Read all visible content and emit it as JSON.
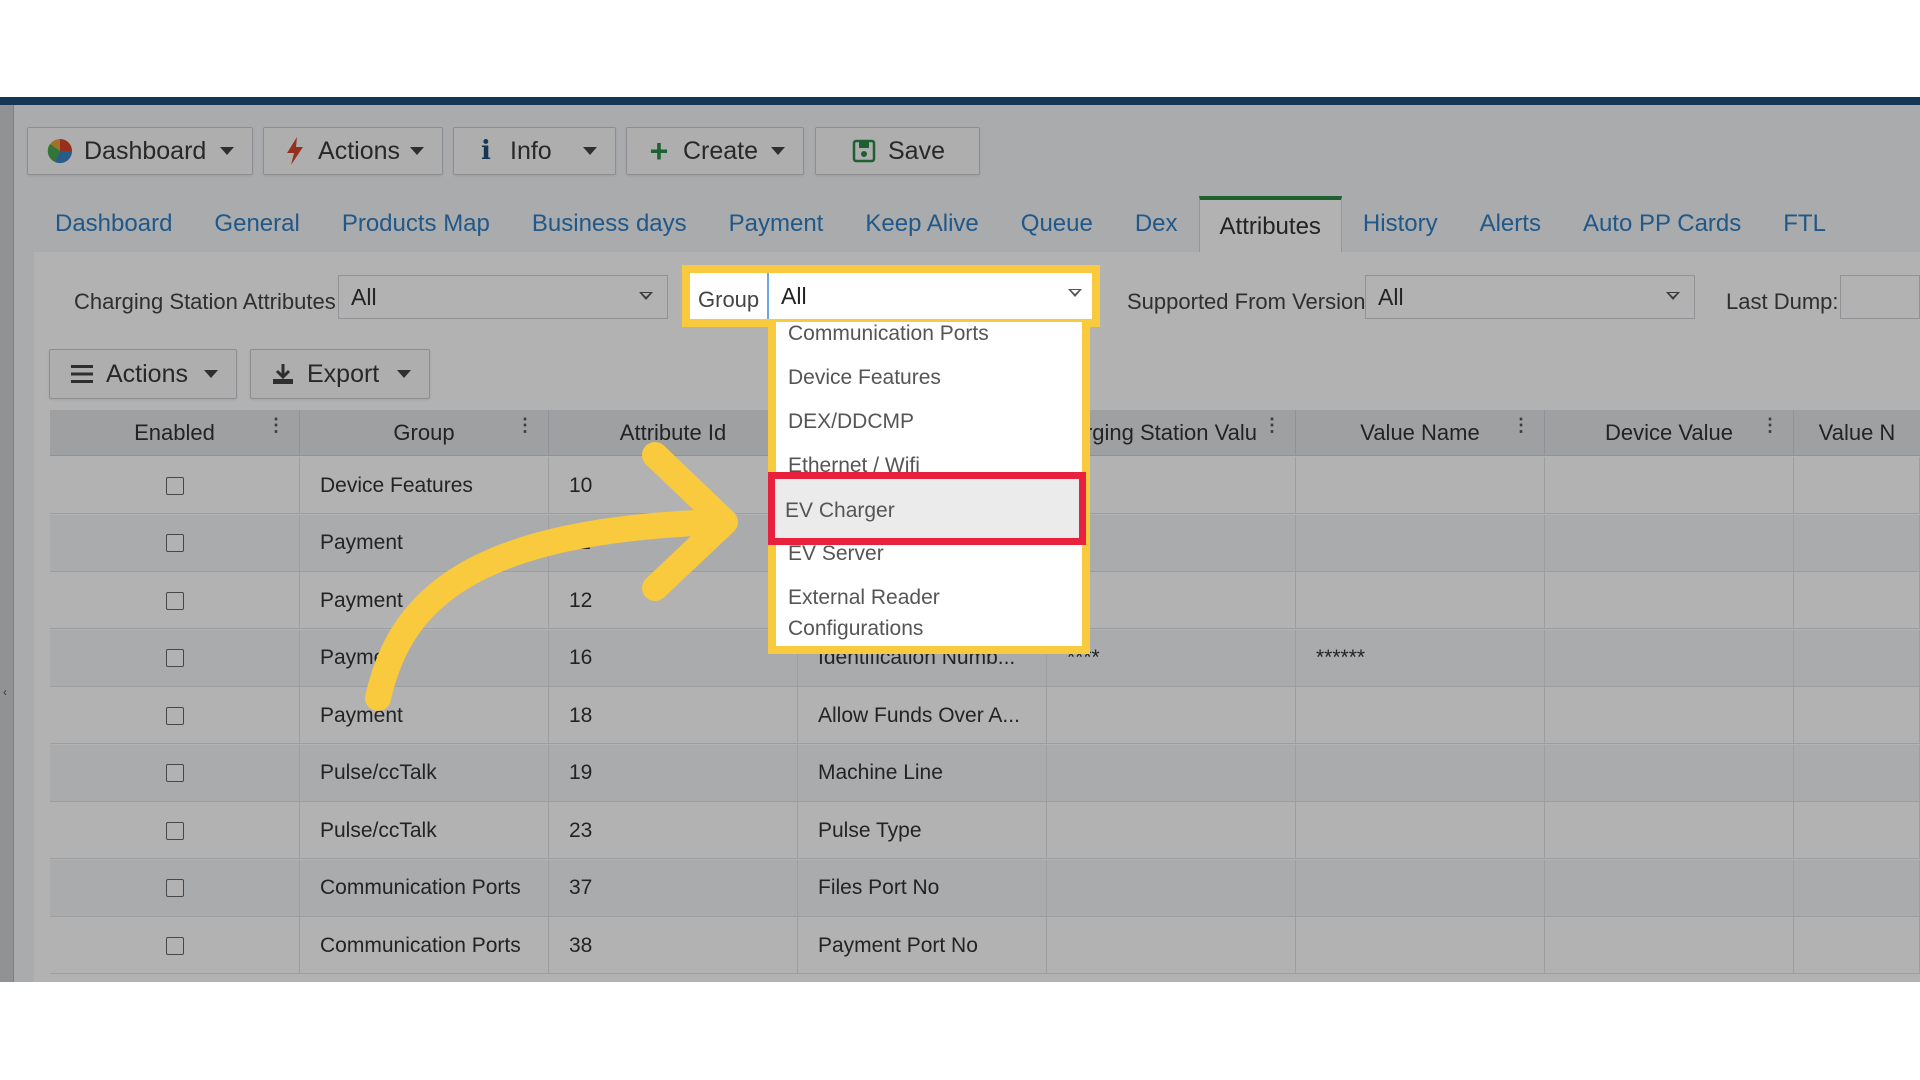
{
  "toolbar": {
    "dashboard": "Dashboard",
    "actions": "Actions",
    "info": "Info",
    "create": "Create",
    "save": "Save"
  },
  "tabs": [
    "Dashboard",
    "General",
    "Products Map",
    "Business days",
    "Payment",
    "Keep Alive",
    "Queue",
    "Dex",
    "Attributes",
    "History",
    "Alerts",
    "Auto PP Cards",
    "FTL"
  ],
  "active_tab": "Attributes",
  "filters": {
    "charging_station_attributes_label": "Charging Station Attributes",
    "charging_station_attributes_value": "All",
    "group_label": "Group",
    "group_value": "All",
    "supported_from_version_label": "Supported From Version",
    "supported_from_version_value": "All",
    "last_dump_label": "Last Dump:"
  },
  "grid_toolbar": {
    "actions": "Actions",
    "export": "Export"
  },
  "grid": {
    "columns": [
      "Enabled",
      "Group",
      "Attribute Id",
      "",
      "rging Station Valu",
      "Value Name",
      "Device Value",
      "Value N"
    ],
    "rows": [
      {
        "group": "Device Features",
        "id": "10",
        "name": "",
        "cs_value": "",
        "value_name": ""
      },
      {
        "group": "Payment",
        "id": "11",
        "name": "",
        "cs_value": "",
        "value_name": ""
      },
      {
        "group": "Payment",
        "id": "12",
        "name": "",
        "cs_value": "",
        "value_name": ""
      },
      {
        "group": "Payme",
        "id": "16",
        "name": "Identification Numb...",
        "cs_value": "****",
        "value_name": "******"
      },
      {
        "group": "Payment",
        "id": "18",
        "name": "Allow Funds Over A...",
        "cs_value": "",
        "value_name": ""
      },
      {
        "group": "Pulse/ccTalk",
        "id": "19",
        "name": "Machine Line",
        "cs_value": "",
        "value_name": ""
      },
      {
        "group": "Pulse/ccTalk",
        "id": "23",
        "name": "Pulse Type",
        "cs_value": "",
        "value_name": ""
      },
      {
        "group": "Communication Ports",
        "id": "37",
        "name": "Files Port No",
        "cs_value": "",
        "value_name": ""
      },
      {
        "group": "Communication Ports",
        "id": "38",
        "name": "Payment Port No",
        "cs_value": "",
        "value_name": ""
      }
    ]
  },
  "group_dropdown": {
    "options": [
      "Communication Ports",
      "Device Features",
      "DEX/DDCMP",
      "Ethernet / Wifi",
      "EV Charger",
      "EV Server",
      "External Reader",
      "Configurations"
    ],
    "highlighted": "EV Charger"
  },
  "colors": {
    "accent_blue": "#2f7fc4",
    "highlight_yellow": "#f9c93e",
    "highlight_red": "#e8213f",
    "active_tab_green": "#2d8a46",
    "topbar": "#1f4e79"
  }
}
